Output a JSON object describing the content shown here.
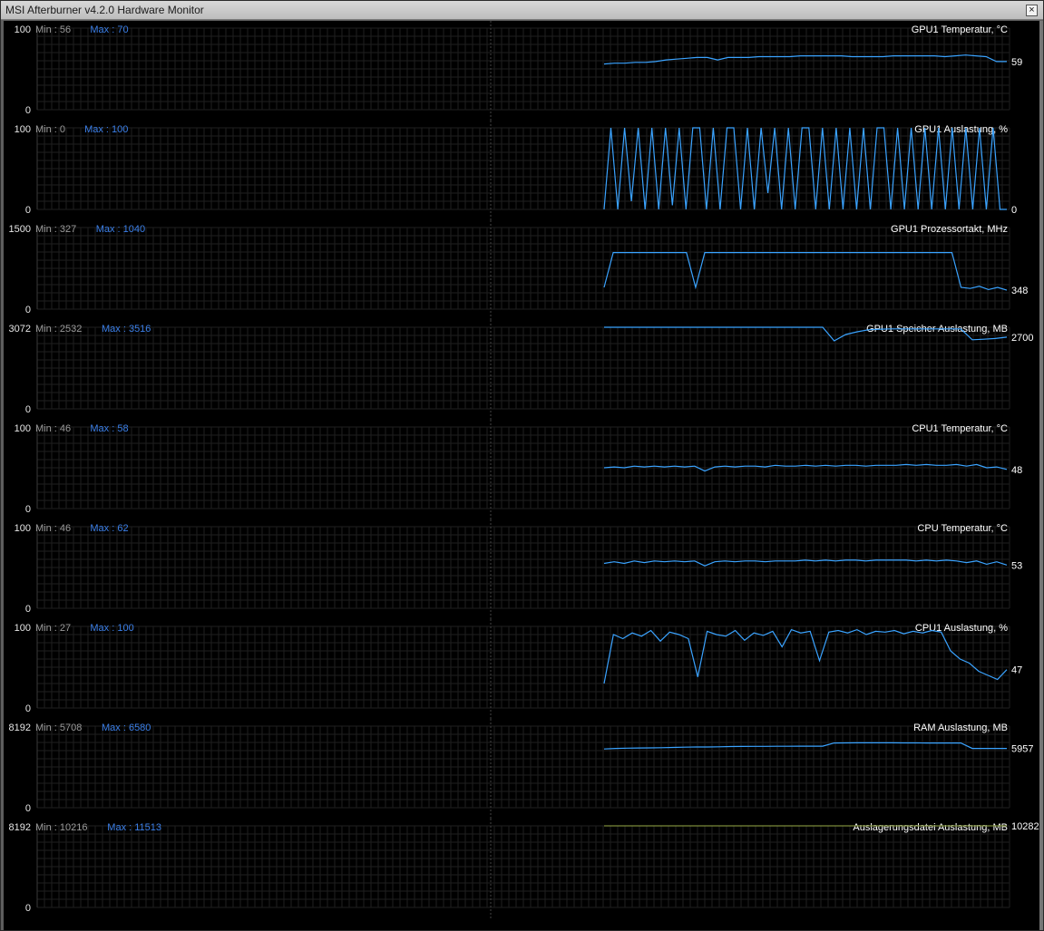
{
  "window": {
    "title": "MSI Afterburner v4.2.0 Hardware Monitor",
    "close_glyph": "×"
  },
  "colors": {
    "trace": "#3aa3ff",
    "flat_trace": "#7a8a3a",
    "min_label": "#9a9a9a",
    "max_label": "#3b7fe8",
    "grid": "#1f1f1f",
    "background": "#000000"
  },
  "graphs": [
    {
      "title": "GPU1 Temperatur, °C",
      "min_label": "Min : 56",
      "max_label": "Max : 70",
      "y_top": "100",
      "y_bottom": "0",
      "current": "59",
      "chart_data": {
        "type": "line",
        "ylim": [
          0,
          100
        ],
        "values": [
          56,
          57,
          57,
          58,
          58,
          59,
          61,
          62,
          63,
          64,
          64,
          61,
          64,
          64,
          64,
          65,
          65,
          65,
          65,
          66,
          66,
          66,
          66,
          66,
          65,
          65,
          65,
          65,
          66,
          66,
          66,
          66,
          66,
          65,
          66,
          67,
          66,
          65,
          59,
          59
        ]
      }
    },
    {
      "title": "GPU1 Auslastung, %",
      "min_label": "Min : 0",
      "max_label": "Max : 100",
      "y_top": "100",
      "y_bottom": "0",
      "current": "0",
      "chart_data": {
        "type": "line",
        "ylim": [
          0,
          100
        ],
        "values": [
          0,
          100,
          0,
          100,
          10,
          100,
          0,
          100,
          0,
          100,
          5,
          100,
          0,
          100,
          100,
          0,
          100,
          0,
          100,
          100,
          0,
          100,
          0,
          100,
          20,
          100,
          0,
          100,
          0,
          100,
          100,
          0,
          100,
          0,
          100,
          0,
          100,
          0,
          100,
          0,
          100,
          100,
          0,
          100,
          0,
          100,
          0,
          100,
          0,
          100,
          0,
          100,
          0,
          100,
          0,
          100,
          0,
          100,
          0,
          0
        ]
      }
    },
    {
      "title": "GPU1 Prozessortakt, MHz",
      "min_label": "Min : 327",
      "max_label": "Max : 1040",
      "y_top": "1500",
      "y_bottom": "0",
      "current": "348",
      "chart_data": {
        "type": "line",
        "ylim": [
          0,
          1500
        ],
        "values": [
          400,
          1040,
          1040,
          1040,
          1040,
          1040,
          1040,
          1040,
          1040,
          1040,
          400,
          1040,
          1040,
          1040,
          1040,
          1040,
          1040,
          1040,
          1040,
          1040,
          1040,
          1040,
          1040,
          1040,
          1040,
          1040,
          1040,
          1040,
          1040,
          1040,
          1040,
          1040,
          1040,
          1040,
          1040,
          1040,
          1040,
          1040,
          1040,
          400,
          380,
          420,
          360,
          400,
          348
        ]
      }
    },
    {
      "title": "GPU1 Speicher Auslastung, MB",
      "min_label": "Min : 2532",
      "max_label": "Max : 3516",
      "y_top": "3072",
      "y_bottom": "0",
      "current": "2700",
      "chart_data": {
        "type": "line",
        "ylim": [
          0,
          3072
        ],
        "values": [
          3072,
          3072,
          3072,
          3072,
          3072,
          3072,
          3072,
          3072,
          3072,
          3072,
          3072,
          3072,
          3072,
          3072,
          3072,
          3072,
          3072,
          3072,
          3072,
          3072,
          2560,
          2800,
          2900,
          2980,
          3000,
          3010,
          3010,
          3010,
          3010,
          3010,
          3010,
          3010,
          2600,
          2620,
          2650,
          2700
        ]
      }
    },
    {
      "title": "CPU1 Temperatur, °C",
      "min_label": "Min : 46",
      "max_label": "Max : 58",
      "y_top": "100",
      "y_bottom": "0",
      "current": "48",
      "chart_data": {
        "type": "line",
        "ylim": [
          0,
          100
        ],
        "values": [
          50,
          51,
          50,
          52,
          51,
          52,
          51,
          52,
          51,
          52,
          46,
          51,
          52,
          51,
          52,
          52,
          51,
          53,
          52,
          52,
          53,
          52,
          53,
          52,
          53,
          53,
          52,
          53,
          53,
          53,
          54,
          53,
          54,
          53,
          53,
          54,
          52,
          54,
          50,
          51,
          48
        ]
      }
    },
    {
      "title": "CPU Temperatur, °C",
      "min_label": "Min : 46",
      "max_label": "Max : 62",
      "y_top": "100",
      "y_bottom": "0",
      "current": "53",
      "chart_data": {
        "type": "line",
        "ylim": [
          0,
          100
        ],
        "values": [
          55,
          57,
          55,
          58,
          56,
          58,
          57,
          58,
          57,
          58,
          52,
          57,
          58,
          57,
          58,
          58,
          57,
          58,
          58,
          58,
          59,
          58,
          59,
          58,
          59,
          59,
          58,
          59,
          59,
          59,
          59,
          58,
          59,
          58,
          59,
          58,
          56,
          58,
          54,
          57,
          53
        ]
      }
    },
    {
      "title": "CPU1 Auslastung, %",
      "min_label": "Min : 27",
      "max_label": "Max : 100",
      "y_top": "100",
      "y_bottom": "0",
      "current": "47",
      "chart_data": {
        "type": "line",
        "ylim": [
          0,
          100
        ],
        "values": [
          30,
          90,
          85,
          92,
          88,
          95,
          82,
          93,
          90,
          85,
          38,
          94,
          90,
          88,
          95,
          83,
          92,
          89,
          94,
          75,
          96,
          92,
          94,
          58,
          93,
          95,
          92,
          96,
          90,
          94,
          93,
          95,
          91,
          94,
          92,
          95,
          93,
          70,
          60,
          55,
          45,
          40,
          35,
          47
        ]
      }
    },
    {
      "title": "RAM Auslastung, MB",
      "min_label": "Min : 5708",
      "max_label": "Max : 6580",
      "y_top": "8192",
      "y_bottom": "0",
      "current": "5957",
      "chart_data": {
        "type": "line",
        "ylim": [
          0,
          8192
        ],
        "values": [
          5900,
          5950,
          5980,
          6000,
          6010,
          6030,
          6050,
          6080,
          6100,
          6100,
          6120,
          6140,
          6150,
          6160,
          6160,
          6170,
          6170,
          6180,
          6180,
          6180,
          6500,
          6510,
          6520,
          6520,
          6520,
          6520,
          6510,
          6510,
          6500,
          6500,
          6500,
          6500,
          5957,
          5957,
          5957,
          5957
        ]
      }
    },
    {
      "title": "Auslagerungsdatei Auslastung, MB",
      "min_label": "Min : 10216",
      "max_label": "Max : 11513",
      "y_top": "8192",
      "y_bottom": "0",
      "current": "10282",
      "chart_data": {
        "type": "line",
        "ylim": [
          0,
          8192
        ],
        "values": [
          8192,
          8192,
          8192,
          8192,
          8192,
          8192,
          8192,
          8192,
          8192,
          8192,
          8192,
          8192
        ]
      }
    }
  ]
}
